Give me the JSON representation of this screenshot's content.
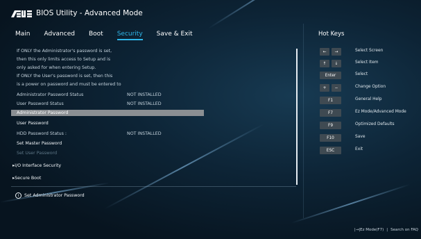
{
  "app": {
    "brand": "ASUS",
    "title": "BIOS Utility - Advanced Mode"
  },
  "menu": {
    "tabs": [
      {
        "label": "Main"
      },
      {
        "label": "Advanced"
      },
      {
        "label": "Boot"
      },
      {
        "label": "Security",
        "active": true
      },
      {
        "label": "Save & Exit"
      }
    ]
  },
  "security": {
    "description": [
      "If ONLY the Administrator's password is set,",
      "then this only limits access to Setup and is",
      "only asked for when entering Setup.",
      "If ONLY the User's password is set, then this",
      "is a power on password and must be entered to"
    ],
    "admin_status_label": "Administrator Password Status",
    "admin_status_value": "NOT INSTALLED",
    "user_status_label": "User Password Status",
    "user_status_value": "NOT INSTALLED",
    "admin_password": "Administrator Password",
    "user_password": "User Password",
    "hdd_status_label": "HDD Password Status :",
    "hdd_status_value": "NOT INSTALLED",
    "set_master_password": "Set Master Password",
    "set_user_password": "Set User Password",
    "io_interface_security": "I/O Interface Security",
    "secure_boot": "Secure Boot",
    "help_text": "Set Administrator Password"
  },
  "hotkeys": {
    "title": "Hot Keys",
    "items": [
      {
        "keys": [
          "←",
          "→"
        ],
        "label": "Select Screen"
      },
      {
        "keys": [
          "↑",
          "↓"
        ],
        "label": "Select Item"
      },
      {
        "keys": [
          "Enter"
        ],
        "label": "Select"
      },
      {
        "keys": [
          "+",
          "−"
        ],
        "label": "Change Option"
      },
      {
        "keys": [
          "F1"
        ],
        "label": "General Help"
      },
      {
        "keys": [
          "F7"
        ],
        "label": "Ez Mode/Advanced Mode"
      },
      {
        "keys": [
          "F9"
        ],
        "label": "Optimized Defaults"
      },
      {
        "keys": [
          "F10"
        ],
        "label": "Save"
      },
      {
        "keys": [
          "ESC"
        ],
        "label": "Exit"
      }
    ]
  },
  "footer": {
    "ez_mode": "|→|Ez Mode(F7)",
    "separator": "|",
    "search": "Search on FAQ"
  },
  "colors": {
    "accent": "#2fb7ea",
    "highlight": "#8b8f93",
    "key_bg": "#3f4a52"
  }
}
